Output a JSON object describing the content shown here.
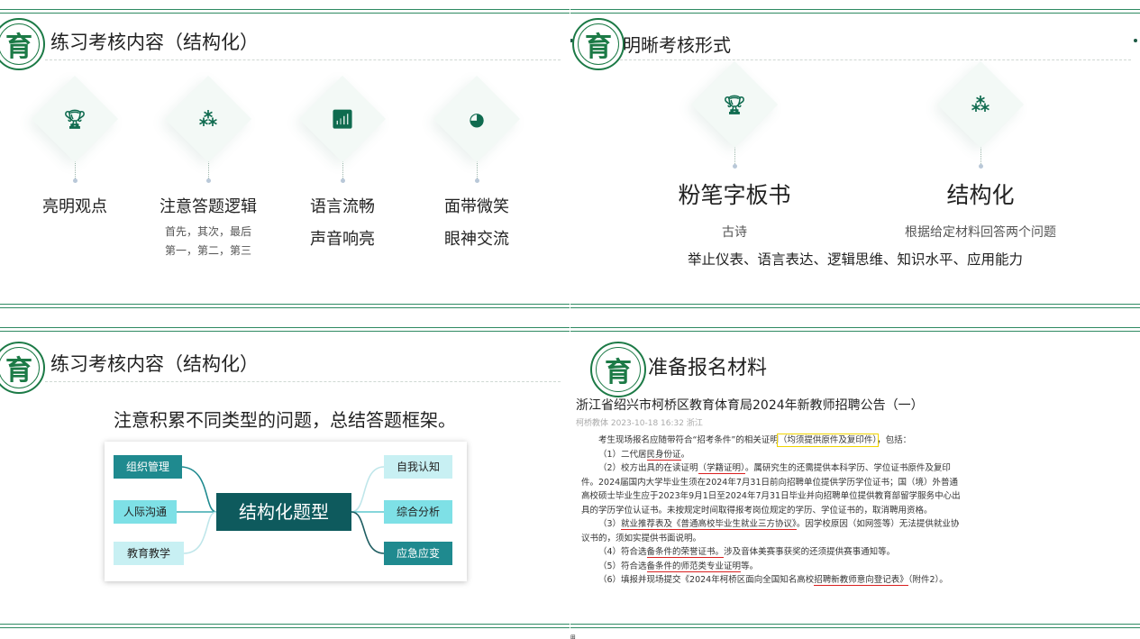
{
  "logo_char": "育",
  "panel1": {
    "title": "练习考核内容（结构化）",
    "cards": [
      {
        "icon": "trophy-icon",
        "glyph": "🏆︎",
        "label": "亮明观点",
        "sub1": "",
        "sub2": ""
      },
      {
        "icon": "sitemap-icon",
        "glyph": "⁂",
        "label": "注意答题逻辑",
        "sub1": "首先，其次，最后",
        "sub2": "第一，第二，第三"
      },
      {
        "icon": "chart-icon",
        "glyph": "📶︎",
        "label": "语言流畅",
        "sub1": "声音响亮",
        "sub2": ""
      },
      {
        "icon": "pie-chart-icon",
        "glyph": "◕",
        "label": "面带微笑",
        "sub1": "眼神交流",
        "sub2": ""
      }
    ]
  },
  "panel2": {
    "title": "明晰考核形式",
    "cards": [
      {
        "icon": "trophy-icon",
        "glyph": "🏆︎",
        "label": "粉笔字板书",
        "sub": "古诗"
      },
      {
        "icon": "sitemap-icon",
        "glyph": "⁂",
        "label": "结构化",
        "sub": "根据给定材料回答两个问题"
      }
    ],
    "summary": "举止仪表、语言表达、逻辑思维、知识水平、应用能力"
  },
  "panel3": {
    "title": "练习考核内容（结构化）",
    "headline": "注意积累不同类型的问题，总结答题框架。",
    "center": "结构化题型",
    "left_nodes": [
      "组织管理",
      "人际沟通",
      "教育教学"
    ],
    "right_nodes": [
      "自我认知",
      "综合分析",
      "应急应变"
    ]
  },
  "panel4": {
    "title": "准备报名材料",
    "doc_title": "浙江省绍兴市柯桥区教育体育局2024年新教师招聘公告（一）",
    "doc_meta": "柯桥教体  2023-10-18 16:32  浙江",
    "l1a": "考生现场报名应随带符合“招考条件”的相关证明",
    "l1b": "（均须提供原件及复印件）",
    "l1c": "，包括：",
    "l2a": "（1）二代居",
    "l2b": "民身份证",
    "l2c": "。",
    "l3a": "（2）校方出具的在读证明",
    "l3b": "（学籍证明）",
    "l3c": "。属研究生的还需提供本科学历、学位证书原件及复印件。2024届国内大学毕业生须在2024年7月31日前向招聘单位提供学历学位证书；国（境）外普通高校硕士毕业生应于2023年9月1日至2024年7月31日毕业并向招聘单位提供教育部留学服务中心出具的学历学位认证书。未按规定时间取得报考岗位规定的学历、学位证书的，取消聘用资格。",
    "l4a": "（3）",
    "l4b": "就业推荐表及《普通高校毕业生就业三方协议》",
    "l4c": "。因学校原因（如网签等）无法提供就业协议书的，须如实提供书面说明。",
    "l5a": "（4）符合选",
    "l5b": "备条件的荣誉证书。",
    "l5c": "涉及音体美赛事获奖的还须提供赛事通知等。",
    "l6a": "（5）符合选",
    "l6b": "备条件的师范类专业证明",
    "l6c": "等。",
    "l7a": "（6）填报并现场提交《2024年柯桥区面向全国知名高校",
    "l7b": "招聘新教师意向登记表》",
    "l7c": "（附件2）。"
  },
  "footer_mark": "⊞",
  "colors": {
    "brand_green": "#1c7a46",
    "teal_dark": "#0e5a5d",
    "teal_light": "#7ee0e6",
    "underline_red": "#d92020",
    "highlight_yellow": "#f0d400"
  }
}
